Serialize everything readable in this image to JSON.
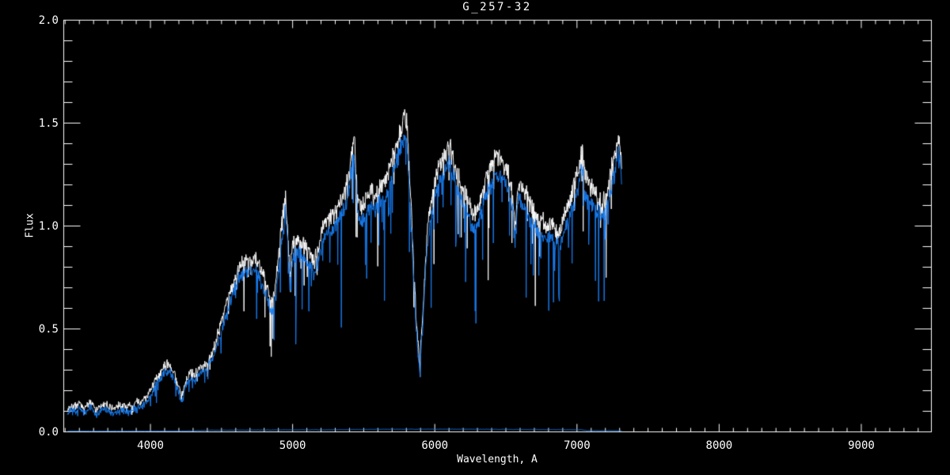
{
  "window": {
    "background": "#000000"
  },
  "chart_data": {
    "type": "line",
    "title": "G_257-32",
    "xlabel": "Wavelength, A",
    "ylabel": "Flux",
    "xlim": [
      3390,
      9493
    ],
    "ylim": [
      0.0,
      2.0
    ],
    "x_major_ticks": [
      {
        "value": 4000,
        "label": "4000"
      },
      {
        "value": 5000,
        "label": "5000"
      },
      {
        "value": 6000,
        "label": "6000"
      },
      {
        "value": 7000,
        "label": "7000"
      },
      {
        "value": 8000,
        "label": "8000"
      },
      {
        "value": 9000,
        "label": "9000"
      }
    ],
    "x_minor_tick_step": 100,
    "y_major_ticks": [
      {
        "value": 0.0,
        "label": "0.0"
      },
      {
        "value": 0.5,
        "label": "0.5"
      },
      {
        "value": 1.0,
        "label": "1.0"
      },
      {
        "value": 1.5,
        "label": "1.5"
      },
      {
        "value": 2.0,
        "label": "2.0"
      }
    ],
    "y_minor_tick_step": 0.1,
    "grid": false,
    "legend": null,
    "background_color": "#000000",
    "axis_color": "#ffffff",
    "series": [
      {
        "name": "spectrum-white",
        "color": "#ffffff",
        "derive": {
          "from": "spectrum-blue",
          "scale": 1.055,
          "offset": 0.018
        },
        "noise": {
          "a0": 0.022,
          "a1": 0.04,
          "spike_prob": 0.1,
          "spike_scale": 0.55,
          "seed": 1337
        }
      },
      {
        "name": "spectrum-blue",
        "color": "#187CF0",
        "noise": {
          "a0": 0.022,
          "a1": 0.04,
          "spike_prob": 0.12,
          "spike_scale": 0.6,
          "seed": 7331
        },
        "points": [
          [
            3416,
            0.08
          ],
          [
            3440,
            0.11
          ],
          [
            3470,
            0.1
          ],
          [
            3500,
            0.12
          ],
          [
            3530,
            0.09
          ],
          [
            3560,
            0.11
          ],
          [
            3590,
            0.12
          ],
          [
            3620,
            0.08
          ],
          [
            3650,
            0.1
          ],
          [
            3680,
            0.11
          ],
          [
            3710,
            0.1
          ],
          [
            3740,
            0.09
          ],
          [
            3770,
            0.1
          ],
          [
            3800,
            0.11
          ],
          [
            3830,
            0.1
          ],
          [
            3860,
            0.1
          ],
          [
            3890,
            0.11
          ],
          [
            3920,
            0.12
          ],
          [
            3950,
            0.13
          ],
          [
            3980,
            0.15
          ],
          [
            4010,
            0.19
          ],
          [
            4040,
            0.23
          ],
          [
            4070,
            0.26
          ],
          [
            4100,
            0.29
          ],
          [
            4130,
            0.3
          ],
          [
            4160,
            0.26
          ],
          [
            4190,
            0.21
          ],
          [
            4220,
            0.14
          ],
          [
            4250,
            0.22
          ],
          [
            4280,
            0.26
          ],
          [
            4310,
            0.25
          ],
          [
            4340,
            0.28
          ],
          [
            4370,
            0.29
          ],
          [
            4400,
            0.31
          ],
          [
            4430,
            0.34
          ],
          [
            4460,
            0.4
          ],
          [
            4490,
            0.47
          ],
          [
            4520,
            0.54
          ],
          [
            4550,
            0.61
          ],
          [
            4580,
            0.67
          ],
          [
            4610,
            0.72
          ],
          [
            4640,
            0.76
          ],
          [
            4670,
            0.78
          ],
          [
            4700,
            0.77
          ],
          [
            4730,
            0.79
          ],
          [
            4760,
            0.76
          ],
          [
            4790,
            0.71
          ],
          [
            4820,
            0.65
          ],
          [
            4850,
            0.58
          ],
          [
            4870,
            0.62
          ],
          [
            4890,
            0.72
          ],
          [
            4910,
            0.85
          ],
          [
            4930,
            0.97
          ],
          [
            4950,
            1.07
          ],
          [
            4965,
            0.92
          ],
          [
            4980,
            0.7
          ],
          [
            5000,
            0.85
          ],
          [
            5030,
            0.88
          ],
          [
            5060,
            0.86
          ],
          [
            5090,
            0.84
          ],
          [
            5120,
            0.81
          ],
          [
            5150,
            0.77
          ],
          [
            5180,
            0.83
          ],
          [
            5210,
            0.92
          ],
          [
            5240,
            0.96
          ],
          [
            5270,
            0.98
          ],
          [
            5300,
            1.0
          ],
          [
            5330,
            1.04
          ],
          [
            5360,
            1.08
          ],
          [
            5390,
            1.15
          ],
          [
            5410,
            1.24
          ],
          [
            5430,
            1.37
          ],
          [
            5445,
            1.2
          ],
          [
            5460,
            1.05
          ],
          [
            5490,
            1.02
          ],
          [
            5520,
            1.06
          ],
          [
            5550,
            1.1
          ],
          [
            5580,
            1.08
          ],
          [
            5610,
            1.1
          ],
          [
            5640,
            1.13
          ],
          [
            5670,
            1.18
          ],
          [
            5700,
            1.24
          ],
          [
            5730,
            1.3
          ],
          [
            5760,
            1.37
          ],
          [
            5790,
            1.44
          ],
          [
            5805,
            1.4
          ],
          [
            5820,
            1.2
          ],
          [
            5845,
            0.85
          ],
          [
            5870,
            0.5
          ],
          [
            5893,
            0.29
          ],
          [
            5915,
            0.52
          ],
          [
            5935,
            0.78
          ],
          [
            5955,
            0.95
          ],
          [
            5980,
            1.07
          ],
          [
            6010,
            1.16
          ],
          [
            6040,
            1.23
          ],
          [
            6070,
            1.27
          ],
          [
            6100,
            1.3
          ],
          [
            6130,
            1.25
          ],
          [
            6160,
            1.17
          ],
          [
            6190,
            1.12
          ],
          [
            6220,
            1.07
          ],
          [
            6250,
            1.02
          ],
          [
            6280,
            0.99
          ],
          [
            6310,
            1.03
          ],
          [
            6340,
            1.1
          ],
          [
            6370,
            1.17
          ],
          [
            6400,
            1.22
          ],
          [
            6430,
            1.25
          ],
          [
            6460,
            1.24
          ],
          [
            6490,
            1.21
          ],
          [
            6520,
            1.17
          ],
          [
            6545,
            1.1
          ],
          [
            6565,
            0.92
          ],
          [
            6585,
            1.1
          ],
          [
            6610,
            1.12
          ],
          [
            6640,
            1.08
          ],
          [
            6670,
            1.04
          ],
          [
            6700,
            1.0
          ],
          [
            6730,
            0.97
          ],
          [
            6760,
            0.95
          ],
          [
            6790,
            0.93
          ],
          [
            6820,
            0.94
          ],
          [
            6850,
            0.92
          ],
          [
            6880,
            0.9
          ],
          [
            6910,
            0.97
          ],
          [
            6940,
            1.03
          ],
          [
            6970,
            1.09
          ],
          [
            7000,
            1.16
          ],
          [
            7035,
            1.28
          ],
          [
            7060,
            1.16
          ],
          [
            7090,
            1.12
          ],
          [
            7120,
            1.1
          ],
          [
            7150,
            1.06
          ],
          [
            7180,
            1.03
          ],
          [
            7210,
            1.08
          ],
          [
            7240,
            1.18
          ],
          [
            7270,
            1.28
          ],
          [
            7295,
            1.36
          ],
          [
            7314,
            1.22
          ]
        ]
      },
      {
        "name": "sky-baseline-blue",
        "color": "#187CF0",
        "noise": {
          "a0": 0.002,
          "a1": 0.0,
          "spike_prob": 0.0,
          "spike_scale": 0.0,
          "seed": 99
        },
        "points": [
          [
            3416,
            0.004
          ],
          [
            4000,
            0.004
          ],
          [
            4300,
            0.005
          ],
          [
            4400,
            0.008
          ],
          [
            4700,
            0.009
          ],
          [
            5000,
            0.01
          ],
          [
            5200,
            0.01
          ],
          [
            5340,
            0.011
          ],
          [
            5700,
            0.013
          ],
          [
            6100,
            0.013
          ],
          [
            6500,
            0.012
          ],
          [
            6900,
            0.011
          ],
          [
            7040,
            0.01
          ],
          [
            7070,
            0.006
          ],
          [
            7200,
            0.006
          ],
          [
            7314,
            0.005
          ]
        ]
      }
    ]
  }
}
